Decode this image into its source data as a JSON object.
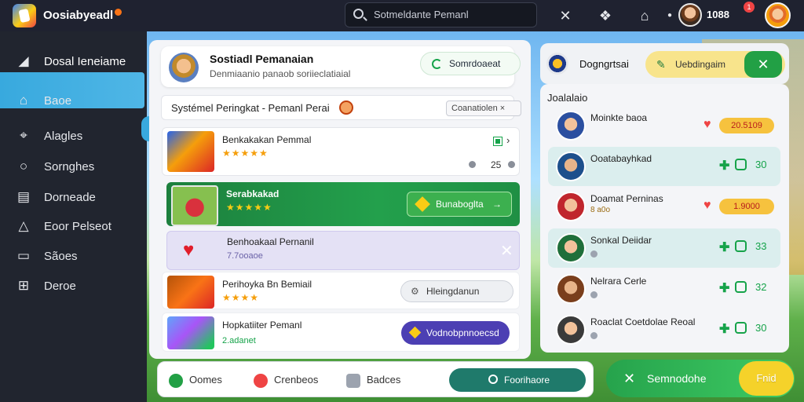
{
  "topbar": {
    "app_title": "Oosiabyeadl",
    "search_placeholder": "Sotmeldante Pemanl",
    "score": "1088",
    "notification_count": "1"
  },
  "sidebar": {
    "items": [
      {
        "label": "Dosal Ieneiame",
        "icon": "rocket-icon",
        "active": true
      },
      {
        "label": "Baoe",
        "icon": "home-icon"
      },
      {
        "label": "Alagles",
        "icon": "cursor-icon"
      },
      {
        "label": "Sornghes",
        "icon": "search-icon"
      },
      {
        "label": "Dorneade",
        "icon": "message-icon"
      },
      {
        "label": "Eoor Pelseot",
        "icon": "shape-icon"
      },
      {
        "label": "Sãoes",
        "icon": "inbox-icon"
      },
      {
        "label": "Deroe",
        "icon": "grid-icon"
      }
    ]
  },
  "header": {
    "title": "Sostiadl Pemanaian",
    "subtitle": "Denmiaanio panaob soriieclatiaial",
    "button_label": "Somrdoaeat"
  },
  "system": {
    "title": "Systémel Peringkat - Pemanl Perai",
    "chip_label": "Coanatiolen"
  },
  "rows": [
    {
      "title": "Benkakakan Pemmal",
      "stars": "★★★★★",
      "count": "25"
    },
    {
      "title": "Serabkakad",
      "stars": "★★★★★",
      "button_label": "Bunaboglta"
    },
    {
      "title": "Benhoakaal Pernanil",
      "sub": "7.7ooaoe"
    },
    {
      "title": "Perihoyka Bn Bemiail",
      "stars": "★★★★",
      "button_label": "Hleingdanun"
    },
    {
      "title": "Hopkatiiter Pemanl",
      "sub": "2.adanet",
      "button_label": "Vodnobpnnoecsd"
    }
  ],
  "bottom_nav": {
    "items": [
      {
        "label": "Oomes",
        "icon": "leaf-icon"
      },
      {
        "label": "Crenbeos",
        "icon": "heart-badge-icon"
      },
      {
        "label": "Badces",
        "icon": "shield-icon"
      }
    ],
    "search_label": "Foorihaore"
  },
  "bottom_right": {
    "label": "Semnodohe",
    "pill_label": "Fnid"
  },
  "right_top": {
    "label": "Dogngrtsai",
    "chip_label": "Uebdingaim"
  },
  "leaderboard": {
    "title": "Joalalaio",
    "rows": [
      {
        "name": "Moinkte baoa",
        "points": "20.5109"
      },
      {
        "name": "Ooatabayhkad",
        "num": "30"
      },
      {
        "name": "Doamat Perninas",
        "sub": "8 a0o",
        "points": "1.9000"
      },
      {
        "name": "Sonkal Deiidar",
        "num": "33"
      },
      {
        "name": "Nelrara Cerle",
        "num": "32"
      },
      {
        "name": "Roaclat Coetdolae Reoal",
        "num": "30"
      }
    ]
  },
  "colors": {
    "sidebar_active": "#38a9de",
    "primary_green": "#23a04c",
    "accent_purple": "#4c3fb3"
  }
}
